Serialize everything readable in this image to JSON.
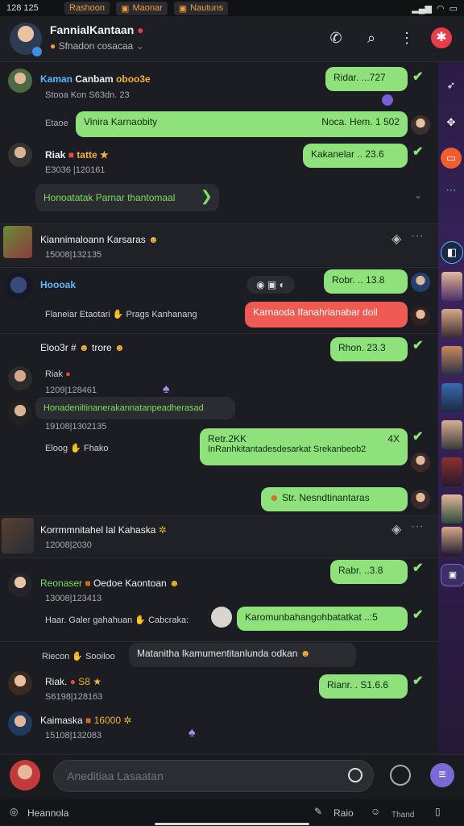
{
  "status_bar": {
    "time": "128 125",
    "notifications": [
      {
        "label": "Rashoon"
      },
      {
        "label": "Maonar"
      },
      {
        "label": "Nautuns"
      }
    ]
  },
  "header": {
    "title": "FannialKantaan",
    "subtitle": "Sfnadon cosacaa"
  },
  "messages": [
    {
      "name": "Kaman",
      "name_extra": "Canbam",
      "emoji": "oboo3e",
      "meta": "Stooa Kon S63dn. 23",
      "out_text": "Ridar. ...727"
    },
    {
      "meta_left": "Etaoe",
      "out_text": "Vinira Karnaobity",
      "out_time": "Noca. Hem. 1 502"
    },
    {
      "name": "Riak",
      "name_extra": "tatte",
      "meta": "E3036 |120161",
      "out_text": "Kakanelar .. 23.6"
    },
    {
      "link_text": "Honoatatak Parnar thantomaal"
    },
    {
      "name": "Kiannimaloann Karsaras",
      "meta": "15008|132135"
    },
    {
      "name": "Hoooak",
      "out_text": "Robr. .. 13.8"
    },
    {
      "meta_left": "Flaneiar Etaotari",
      "meta_right": "Prags Kanhanang",
      "red_text": "Karnaoda Ifanahrianabar doil"
    },
    {
      "name": "Eloo3r #",
      "name_extra": "trore",
      "out_text": "Rhon. 23.3",
      "sub": "Riak",
      "meta": "1209|128461"
    },
    {
      "in_text": "Honadeniltinanerakannatanpeadherasad",
      "meta": "19108|1302135"
    },
    {
      "meta_left": "Eloog",
      "meta_right": "Fhako",
      "out_line1": "Retr.2KK",
      "out_line2": "InRanhkitantadesdesarkat Srekanbeob2",
      "out_corner": "4X"
    },
    {
      "out_text": "Str. Nesndtinantaras"
    },
    {
      "name": "Korrmmnitahel lal Kahaska",
      "meta": "12008|2030"
    },
    {
      "out_text": "Rabr. ..3.8"
    },
    {
      "name": "Reonaser",
      "name_extra": "Oedoe Kaontoan",
      "meta": "13008|123413",
      "meta2_left": "Haar.",
      "meta2_mid": "Galer gahahuan",
      "meta2_right": "Cabcraka:",
      "out_text": "Karomunbahangohbatatkat ..:5"
    },
    {
      "meta_left": "Riecon",
      "meta_mid": "Sooiloo",
      "in_text": "Matanitha lkamumentitanlunda odkan"
    },
    {
      "name": "Riak.",
      "name_extra": "S8",
      "meta": "S6198|128163",
      "out_text": "Rianr. . S1.6.6"
    },
    {
      "name": "Kaimaska",
      "name_extra": "16000",
      "meta": "15108|132083"
    }
  ],
  "composer": {
    "placeholder": "Aneditiaa Lasaatan"
  },
  "bottom_bar": {
    "left_label": "Heannola",
    "right_label": "Raio",
    "third_label": "Thand"
  },
  "colors": {
    "outgoing_bubble": "#8fe27b",
    "alert_bubble": "#ef5a52",
    "accent_red": "#e63e4b"
  }
}
